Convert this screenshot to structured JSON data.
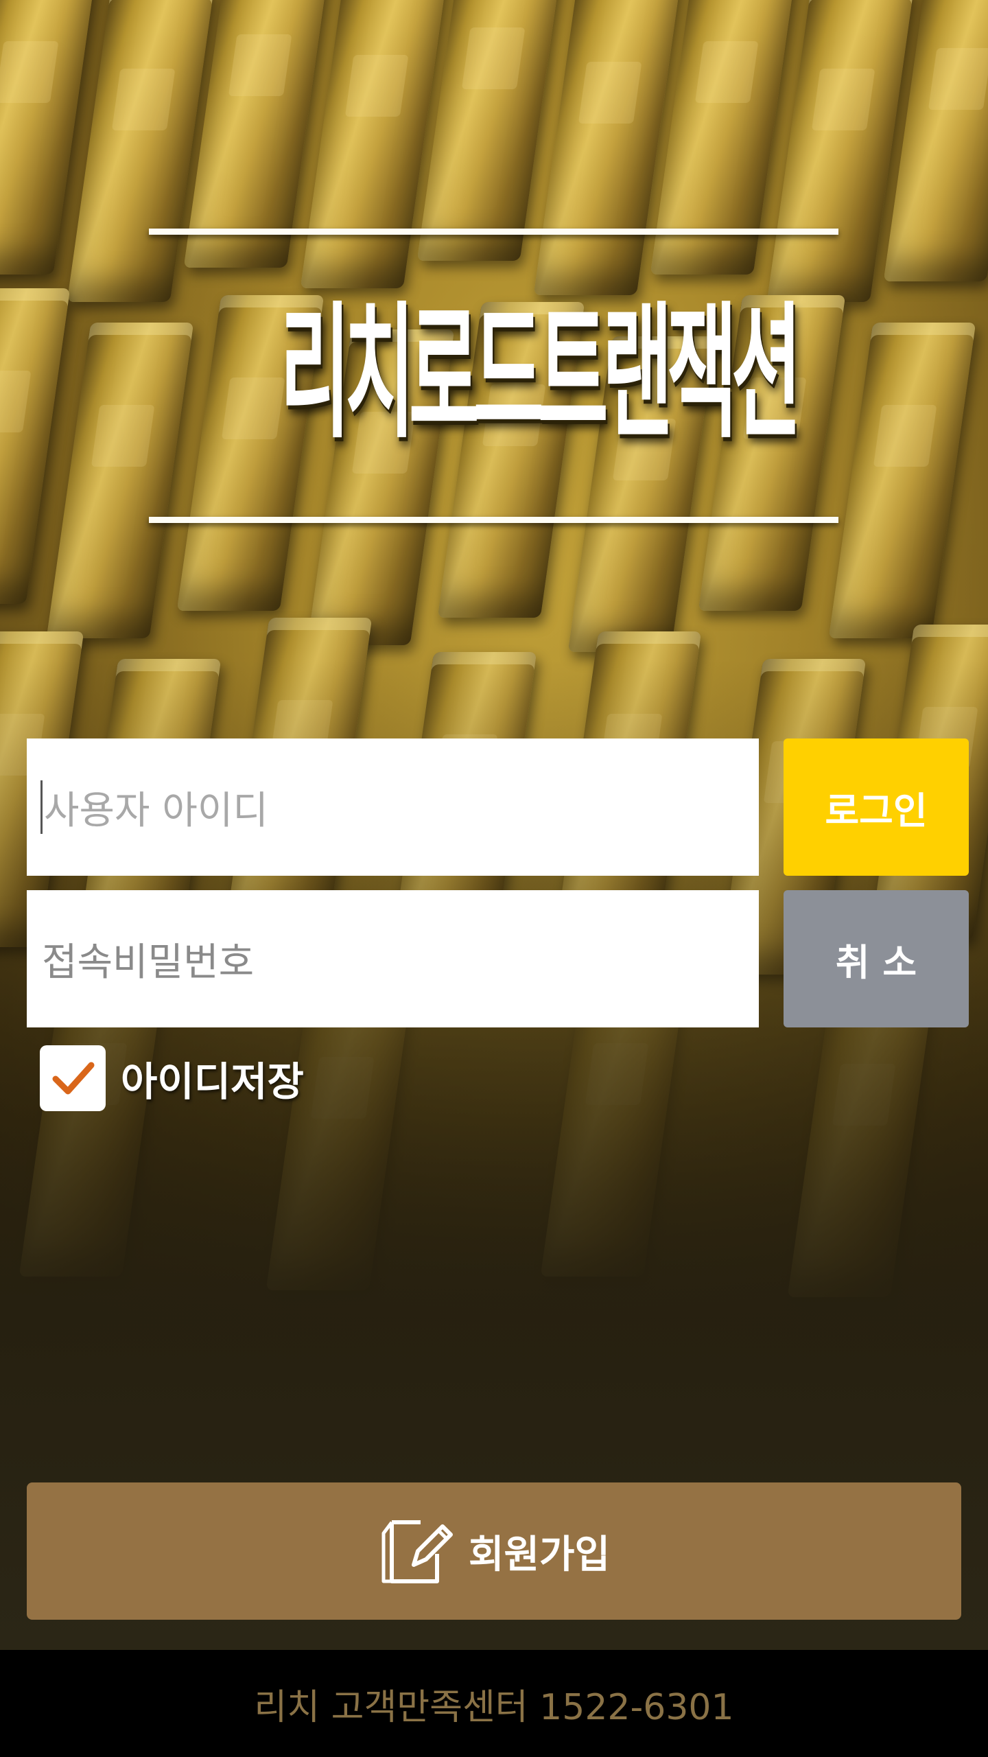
{
  "app": {
    "title": "리치로드트랜잭션"
  },
  "login_form": {
    "username_placeholder": "사용자 아이디",
    "password_placeholder": "접속비밀번호",
    "login_label": "로그인",
    "cancel_label": "취 소",
    "remember_label": "아이디저장",
    "remember_checked": true
  },
  "signup": {
    "label": "회원가입",
    "icon": "edit-document-icon"
  },
  "footer": {
    "text": "리치 고객만족센터 1522-6301"
  },
  "colors": {
    "login_button": "#ffd000",
    "cancel_button": "#8c9098",
    "signup_button": "#957244",
    "check_mark": "#d9661a",
    "footer_text": "#8a7246"
  }
}
